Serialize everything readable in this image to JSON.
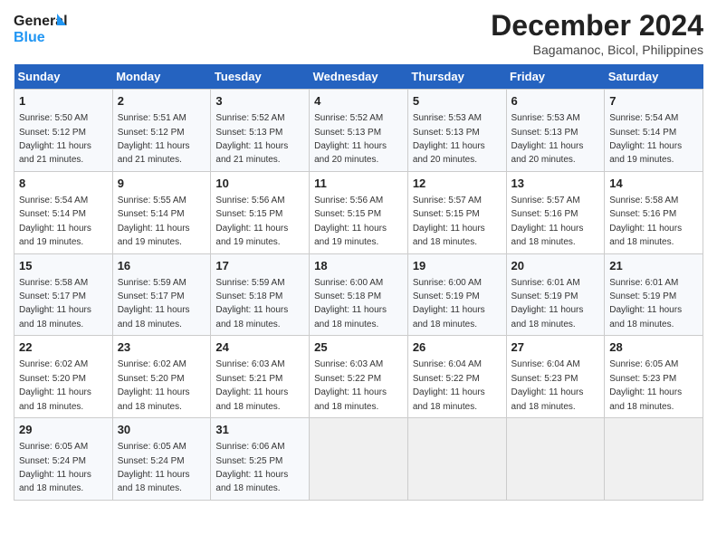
{
  "logo": {
    "line1": "General",
    "line2": "Blue"
  },
  "title": "December 2024",
  "subtitle": "Bagamanoc, Bicol, Philippines",
  "days_header": [
    "Sunday",
    "Monday",
    "Tuesday",
    "Wednesday",
    "Thursday",
    "Friday",
    "Saturday"
  ],
  "weeks": [
    [
      {
        "day": "1",
        "rise": "5:50 AM",
        "set": "5:12 PM",
        "light": "11 hours and 21 minutes"
      },
      {
        "day": "2",
        "rise": "5:51 AM",
        "set": "5:12 PM",
        "light": "11 hours and 21 minutes"
      },
      {
        "day": "3",
        "rise": "5:52 AM",
        "set": "5:13 PM",
        "light": "11 hours and 21 minutes"
      },
      {
        "day": "4",
        "rise": "5:52 AM",
        "set": "5:13 PM",
        "light": "11 hours and 20 minutes"
      },
      {
        "day": "5",
        "rise": "5:53 AM",
        "set": "5:13 PM",
        "light": "11 hours and 20 minutes"
      },
      {
        "day": "6",
        "rise": "5:53 AM",
        "set": "5:13 PM",
        "light": "11 hours and 20 minutes"
      },
      {
        "day": "7",
        "rise": "5:54 AM",
        "set": "5:14 PM",
        "light": "11 hours and 19 minutes"
      }
    ],
    [
      {
        "day": "8",
        "rise": "5:54 AM",
        "set": "5:14 PM",
        "light": "11 hours and 19 minutes"
      },
      {
        "day": "9",
        "rise": "5:55 AM",
        "set": "5:14 PM",
        "light": "11 hours and 19 minutes"
      },
      {
        "day": "10",
        "rise": "5:56 AM",
        "set": "5:15 PM",
        "light": "11 hours and 19 minutes"
      },
      {
        "day": "11",
        "rise": "5:56 AM",
        "set": "5:15 PM",
        "light": "11 hours and 19 minutes"
      },
      {
        "day": "12",
        "rise": "5:57 AM",
        "set": "5:15 PM",
        "light": "11 hours and 18 minutes"
      },
      {
        "day": "13",
        "rise": "5:57 AM",
        "set": "5:16 PM",
        "light": "11 hours and 18 minutes"
      },
      {
        "day": "14",
        "rise": "5:58 AM",
        "set": "5:16 PM",
        "light": "11 hours and 18 minutes"
      }
    ],
    [
      {
        "day": "15",
        "rise": "5:58 AM",
        "set": "5:17 PM",
        "light": "11 hours and 18 minutes"
      },
      {
        "day": "16",
        "rise": "5:59 AM",
        "set": "5:17 PM",
        "light": "11 hours and 18 minutes"
      },
      {
        "day": "17",
        "rise": "5:59 AM",
        "set": "5:18 PM",
        "light": "11 hours and 18 minutes"
      },
      {
        "day": "18",
        "rise": "6:00 AM",
        "set": "5:18 PM",
        "light": "11 hours and 18 minutes"
      },
      {
        "day": "19",
        "rise": "6:00 AM",
        "set": "5:19 PM",
        "light": "11 hours and 18 minutes"
      },
      {
        "day": "20",
        "rise": "6:01 AM",
        "set": "5:19 PM",
        "light": "11 hours and 18 minutes"
      },
      {
        "day": "21",
        "rise": "6:01 AM",
        "set": "5:19 PM",
        "light": "11 hours and 18 minutes"
      }
    ],
    [
      {
        "day": "22",
        "rise": "6:02 AM",
        "set": "5:20 PM",
        "light": "11 hours and 18 minutes"
      },
      {
        "day": "23",
        "rise": "6:02 AM",
        "set": "5:20 PM",
        "light": "11 hours and 18 minutes"
      },
      {
        "day": "24",
        "rise": "6:03 AM",
        "set": "5:21 PM",
        "light": "11 hours and 18 minutes"
      },
      {
        "day": "25",
        "rise": "6:03 AM",
        "set": "5:22 PM",
        "light": "11 hours and 18 minutes"
      },
      {
        "day": "26",
        "rise": "6:04 AM",
        "set": "5:22 PM",
        "light": "11 hours and 18 minutes"
      },
      {
        "day": "27",
        "rise": "6:04 AM",
        "set": "5:23 PM",
        "light": "11 hours and 18 minutes"
      },
      {
        "day": "28",
        "rise": "6:05 AM",
        "set": "5:23 PM",
        "light": "11 hours and 18 minutes"
      }
    ],
    [
      {
        "day": "29",
        "rise": "6:05 AM",
        "set": "5:24 PM",
        "light": "11 hours and 18 minutes"
      },
      {
        "day": "30",
        "rise": "6:05 AM",
        "set": "5:24 PM",
        "light": "11 hours and 18 minutes"
      },
      {
        "day": "31",
        "rise": "6:06 AM",
        "set": "5:25 PM",
        "light": "11 hours and 18 minutes"
      },
      null,
      null,
      null,
      null
    ]
  ],
  "labels": {
    "sunrise": "Sunrise:",
    "sunset": "Sunset:",
    "daylight": "Daylight:"
  }
}
